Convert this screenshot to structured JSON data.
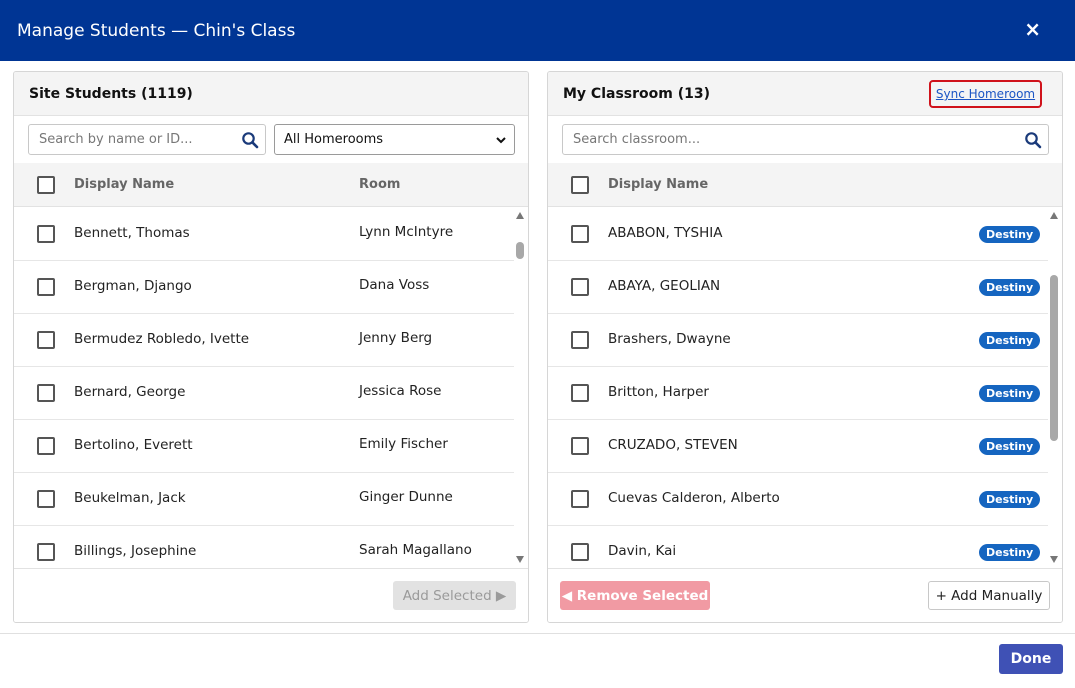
{
  "dialog": {
    "title": "Manage Students — Chin's Class",
    "close_label": "×",
    "done_label": "Done"
  },
  "left": {
    "title": "Site Students (1119)",
    "search_placeholder": "Search by name or ID...",
    "homeroom_selected": "All Homerooms",
    "col_name": "Display Name",
    "col_room": "Room",
    "rows": [
      {
        "name": "Bennett, Thomas",
        "room": "Lynn McIntyre"
      },
      {
        "name": "Bergman, Django",
        "room": "Dana Voss"
      },
      {
        "name": "Bermudez Robledo, Ivette",
        "room": "Jenny Berg"
      },
      {
        "name": "Bernard, George",
        "room": "Jessica Rose"
      },
      {
        "name": "Bertolino, Everett",
        "room": "Emily Fischer"
      },
      {
        "name": "Beukelman, Jack",
        "room": "Ginger Dunne"
      },
      {
        "name": "Billings, Josephine",
        "room": "Sarah Magallano"
      }
    ],
    "add_selected_label": "Add Selected ▶"
  },
  "right": {
    "title": "My Classroom (13)",
    "sync_label": "Sync Homeroom",
    "search_placeholder": "Search classroom...",
    "col_name": "Display Name",
    "rows": [
      {
        "name": "ABABON, TYSHIA",
        "badge": "Destiny"
      },
      {
        "name": "ABAYA, GEOLIAN",
        "badge": "Destiny"
      },
      {
        "name": "Brashers, Dwayne",
        "badge": "Destiny"
      },
      {
        "name": "Britton, Harper",
        "badge": "Destiny"
      },
      {
        "name": "CRUZADO, STEVEN",
        "badge": "Destiny"
      },
      {
        "name": "Cuevas Calderon, Alberto",
        "badge": "Destiny"
      },
      {
        "name": "Davin, Kai",
        "badge": "Destiny"
      }
    ],
    "remove_selected_label": "◀ Remove Selected",
    "add_manually_label": "+ Add Manually"
  },
  "colors": {
    "header_bg": "#003594",
    "badge": "#1565c0",
    "done": "#3f51b5",
    "remove": "#f19aa3",
    "highlight_border": "#d0121b"
  },
  "icons": {
    "search": "search-icon",
    "close": "close-icon",
    "dropdown": "chevron-down-icon"
  }
}
